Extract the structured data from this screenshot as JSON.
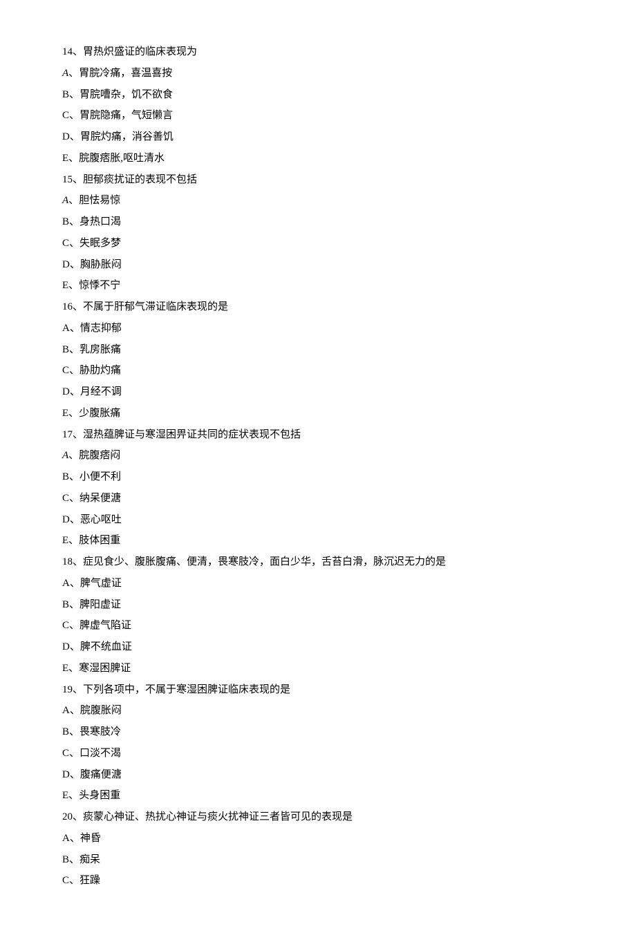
{
  "questions": [
    {
      "num": "14",
      "stem": "胃热炽盛证的临床表现为",
      "options": [
        {
          "label": "A",
          "italic": true,
          "text": "胃脘冷痛，喜温喜按"
        },
        {
          "label": "B",
          "italic": false,
          "text": "胃脘嘈杂，饥不欲食"
        },
        {
          "label": "C",
          "italic": false,
          "text": "胃脘隐痛，气短懒言"
        },
        {
          "label": "D",
          "italic": false,
          "text": "胃脘灼痛，消谷善饥"
        },
        {
          "label": "E",
          "italic": false,
          "text": "脘腹痞胀,呕吐清水"
        }
      ]
    },
    {
      "num": "15",
      "stem": "胆郁痰扰证的表现不包括",
      "options": [
        {
          "label": "A",
          "italic": true,
          "text": "胆怯易惊"
        },
        {
          "label": "B",
          "italic": false,
          "text": "身热口渴"
        },
        {
          "label": "C",
          "italic": false,
          "text": "失眠多梦"
        },
        {
          "label": "D",
          "italic": false,
          "text": "胸胁胀闷"
        },
        {
          "label": "E",
          "italic": false,
          "text": "惊悸不宁"
        }
      ]
    },
    {
      "num": "16",
      "stem": "不属于肝郁气滞证临床表现的是",
      "options": [
        {
          "label": "A",
          "italic": false,
          "text": "情志抑郁"
        },
        {
          "label": "B",
          "italic": false,
          "text": "乳房胀痛"
        },
        {
          "label": "C",
          "italic": false,
          "text": "胁肋灼痛"
        },
        {
          "label": "D",
          "italic": false,
          "text": "月经不调"
        },
        {
          "label": "E",
          "italic": false,
          "text": "少腹胀痛"
        }
      ]
    },
    {
      "num": "17",
      "stem": "湿热蕴脾证与寒湿困畀证共同的症状表现不包括",
      "options": [
        {
          "label": "A",
          "italic": true,
          "text": "脘腹痞闷"
        },
        {
          "label": "B",
          "italic": false,
          "text": "小便不利"
        },
        {
          "label": "C",
          "italic": false,
          "text": "纳呆便溏"
        },
        {
          "label": "D",
          "italic": false,
          "text": "恶心呕吐"
        },
        {
          "label": "E",
          "italic": false,
          "text": "肢体困重"
        }
      ]
    },
    {
      "num": "18",
      "stem": "症见食少、腹胀腹痛、便清，畏寒肢冷，面白少华，舌苔白滑，脉沉迟无力的是",
      "options": [
        {
          "label": "A",
          "italic": false,
          "text": "脾气虚证"
        },
        {
          "label": "B",
          "italic": false,
          "text": "脾阳虚证"
        },
        {
          "label": "C",
          "italic": false,
          "text": "脾虚气陷证"
        },
        {
          "label": "D",
          "italic": false,
          "text": "脾不统血证"
        },
        {
          "label": "E",
          "italic": false,
          "text": "寒湿困脾证"
        }
      ]
    },
    {
      "num": "19",
      "stem": "下列各项中，不属于寒湿困脾证临床表现的是",
      "options": [
        {
          "label": "A",
          "italic": false,
          "text": "脘腹胀闷"
        },
        {
          "label": "B",
          "italic": false,
          "text": "畏寒肢冷"
        },
        {
          "label": "C",
          "italic": false,
          "text": "口淡不渴"
        },
        {
          "label": "D",
          "italic": false,
          "text": "腹痛便溏"
        },
        {
          "label": "E",
          "italic": false,
          "text": "头身困重"
        }
      ]
    },
    {
      "num": "20",
      "stem": "痰蒙心神证、热扰心神证与痰火扰神证三者皆可见的表现是",
      "options": [
        {
          "label": "A",
          "italic": false,
          "text": "神昏"
        },
        {
          "label": "B",
          "italic": false,
          "text": "痴呆"
        },
        {
          "label": "C",
          "italic": false,
          "text": "狂躁"
        }
      ]
    }
  ]
}
